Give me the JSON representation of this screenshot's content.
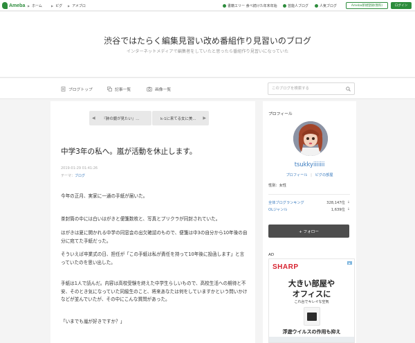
{
  "topbar": {
    "logo": "Ameba",
    "nav": [
      "ホーム",
      "ピグ",
      "アメブロ"
    ],
    "right_links": [
      "書籍エリー 食べ続けた年末年始",
      "芸能人ブログ",
      "人気ブログ"
    ],
    "signup": "Ameba新規登録(無料)",
    "login": "ログイン"
  },
  "blog": {
    "title": "渋谷ではたらく編集見習い改め番組作り見習いのブログ",
    "description": "インターネットメディアで編集者をしていたと思ったら番組作り見習いになっていた"
  },
  "subnav": {
    "items": [
      "ブログトップ",
      "記事一覧",
      "画像一覧"
    ],
    "search_placeholder": "このブログを検索する"
  },
  "pager": {
    "prev": "『肺の鏡が見たい』…",
    "next": "k-1に来てる女に美…"
  },
  "post": {
    "title": "中学3年の私へ。嵐が活動を休止します。",
    "date": "2019-01-29 01:41:26",
    "theme_label": "テーマ：",
    "theme": "ブログ",
    "paragraphs": [
      "今年の正月、実家に一通の手紙が届いた。",
      "茶封筒の中には白いはがきと便箋数枚と、写真とプリクラが同封されていた。",
      "はがきは夏に開かれる中学の同窓会の出欠確認のもので、便箋は中3の自分から10年後の自分に宛てた手紙だった。",
      "そういえば卒業式の日、担任が「この手紙は私が責任を持って10年後に投函します」と言っていたのを思い出した。",
      "手紙は1人で読んだ。内容は高校受験を終えた中学生らしいもので、高校生活への期待と不安、そのとき気になっていた同級生のこと、将来あなたは何をしていますかという問いかけなどが並んでいたが、その中にこんな質問があった。",
      "「いまでも嵐が好きですか？」"
    ]
  },
  "sidebar": {
    "profile_heading": "プロフィール",
    "username": "tsukkyiiiiiii",
    "links": [
      "プロフィール",
      "ピグの部屋"
    ],
    "gender": "性別：女性",
    "rankings": [
      {
        "label": "全体ブログランキング",
        "value": "328,147位",
        "arrow": "↓"
      },
      {
        "label": "OLジャンル",
        "value": "1,639位",
        "arrow": "↓"
      }
    ],
    "follow": "+ フォロー"
  },
  "ad": {
    "label": "AD",
    "brand": "SHARP",
    "headline1": "大きい部屋や",
    "headline2": "オフィスに",
    "sub": "これ台でキレイな空気",
    "bottom": "浮遊ウイルスの作用も抑え"
  },
  "colors": {
    "ameba_green": "#2d8c3c",
    "link_blue": "#3a7bbf",
    "sharp_red": "#d7212e"
  }
}
